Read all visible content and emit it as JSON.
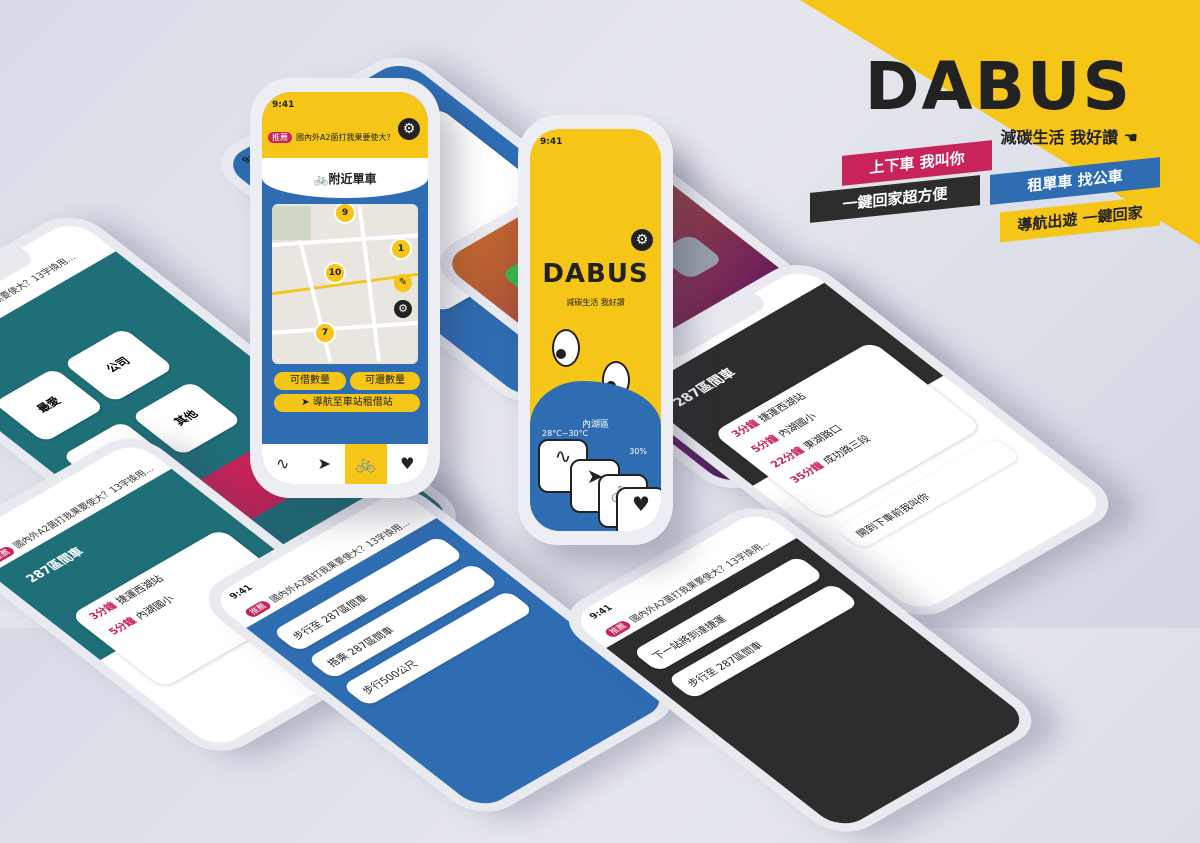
{
  "brand": {
    "name": "DABUS",
    "slogan": "減碳生活 我好讚",
    "slogan_icon": "pointing-hand-icon"
  },
  "ribbons": {
    "r1": "上下車 我叫你",
    "r2": "租單車 找公車",
    "r3": "一鍵回家超方便",
    "r4": "導航出遊 一鍵回家"
  },
  "phone_common": {
    "time": "9:41",
    "tag": "推薦",
    "ticker": "國內外A2菌打我果要使大？13字換用..."
  },
  "bike_phone": {
    "title": "附近單車",
    "map_bubbles": [
      "9",
      "10",
      "1",
      "7"
    ],
    "btn_rent": "可借數量",
    "btn_return": "可還數量",
    "btn_nav": "導航至車站租借站",
    "accent": "#2f6db3",
    "yellow": "#f5c518"
  },
  "home_phone": {
    "logo": "DABUS",
    "sub": "減碳生活 我好讚",
    "weather_label": "內湖區",
    "weather_temp": "28°C~30°C",
    "weather_rain": "30%",
    "blue": "#2f6db3"
  },
  "fav_phone": {
    "items": [
      "最愛",
      "公司",
      "學校",
      "其他"
    ]
  },
  "bus_phone": {
    "title": "287區間車",
    "stops": [
      {
        "time": "3分鐘",
        "name": "捷運西湖站"
      },
      {
        "time": "5分鐘",
        "name": "內湖國小"
      },
      {
        "time": "22分鐘",
        "name": "東湖路口"
      },
      {
        "time": "35分鐘",
        "name": "成功路三段"
      }
    ],
    "note": "開到下車前我叫你"
  },
  "route_phone": {
    "steps": [
      "步行至 287區間車",
      "搭乘 287區間車",
      "步行500公尺",
      "下一站將到達捷運"
    ]
  },
  "colors": {
    "yellow": "#f5c518",
    "blue": "#2f6db3",
    "pink": "#c8235a",
    "teal": "#1f6f78",
    "dark": "#2d2d2d"
  }
}
